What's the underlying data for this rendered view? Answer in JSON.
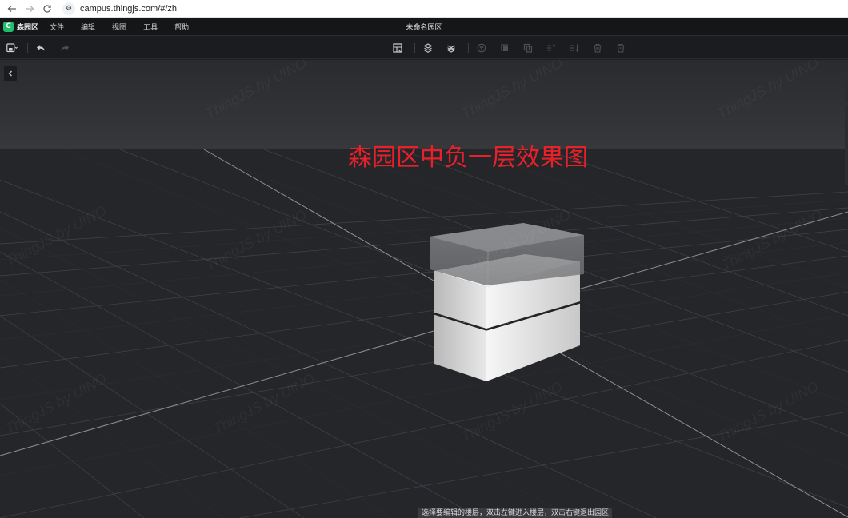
{
  "browser": {
    "url": "campus.thingjs.com/#/zh"
  },
  "app": {
    "brand_name": "森园区",
    "window_title": "未命名园区",
    "menu": [
      "文件",
      "编辑",
      "视图",
      "工具",
      "帮助"
    ],
    "accent_color": "#1fbf6d"
  },
  "toolbar": {
    "left_icons": [
      "save-icon",
      "undo-icon",
      "redo-icon"
    ],
    "center_icons": [
      "layout-icon",
      "layers-up-icon",
      "layers-down-icon",
      "upload-icon",
      "copy-icon",
      "paste-icon",
      "move-up-icon",
      "move-down-icon",
      "delete-icon",
      "delete-all-icon"
    ]
  },
  "viewport": {
    "overlay_title": "森园区中负一层效果图",
    "overlay_color": "#e8202a",
    "watermark": "ThingJS by UINO",
    "status_hint": "选择要编辑的楼层，双击左键进入楼层，双击右键退出园区"
  }
}
